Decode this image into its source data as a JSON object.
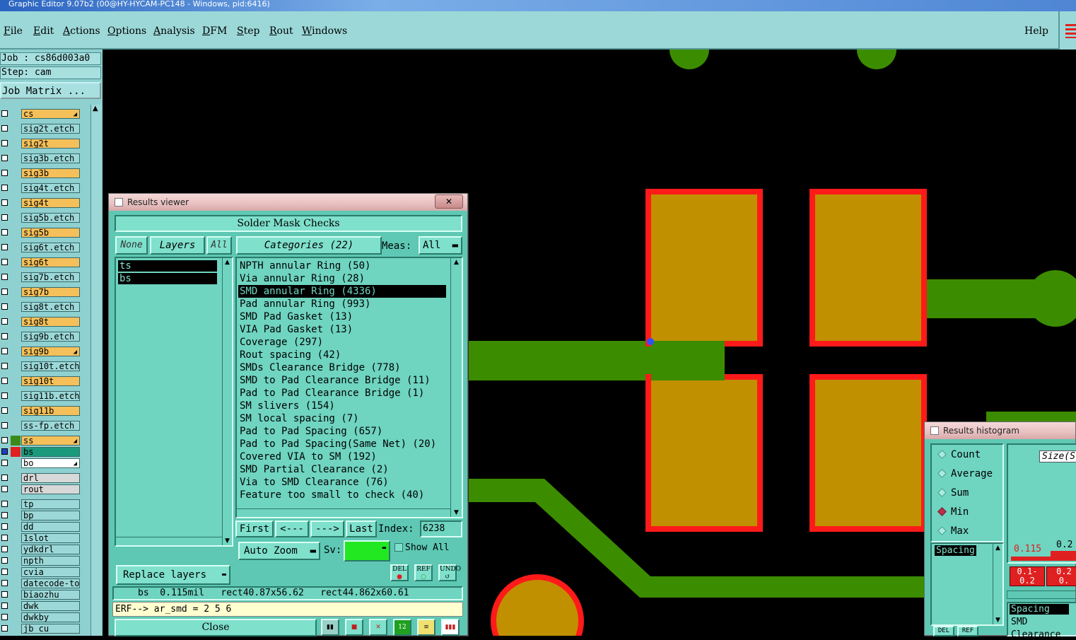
{
  "window": {
    "title": "Graphic Editor 9.07b2 (00@HY-HYCAM-PC148 - Windows, pid:6416)"
  },
  "menu": {
    "items": [
      {
        "label": "File",
        "u": "F",
        "rest": "ile"
      },
      {
        "label": "Edit",
        "u": "E",
        "rest": "dit"
      },
      {
        "label": "Actions",
        "u": "A",
        "rest": "ctions"
      },
      {
        "label": "Options",
        "u": "O",
        "rest": "ptions"
      },
      {
        "label": "Analysis",
        "u": "A",
        "rest": "nalysis"
      },
      {
        "label": "DFM",
        "u": "D",
        "rest": "FM"
      },
      {
        "label": "Step",
        "u": "S",
        "rest": "tep"
      },
      {
        "label": "Rout",
        "u": "R",
        "rest": "out"
      },
      {
        "label": "Windows",
        "u": "W",
        "rest": "indows"
      }
    ],
    "help": "Help"
  },
  "left": {
    "job": "Job : cs86d003a0",
    "step": "Step: cam",
    "job_matrix": "Job Matrix ...",
    "layers": [
      {
        "name": "cs",
        "color": "#f5c05a",
        "arrow": true
      },
      {
        "name": "sig2t.etch",
        "color": "#9cd8d8"
      },
      {
        "name": "sig2t",
        "color": "#f5c05a"
      },
      {
        "name": "sig3b.etch",
        "color": "#9cd8d8"
      },
      {
        "name": "sig3b",
        "color": "#f5c05a"
      },
      {
        "name": "sig4t.etch",
        "color": "#9cd8d8"
      },
      {
        "name": "sig4t",
        "color": "#f5c05a"
      },
      {
        "name": "sig5b.etch",
        "color": "#9cd8d8"
      },
      {
        "name": "sig5b",
        "color": "#f5c05a"
      },
      {
        "name": "sig6t.etch",
        "color": "#9cd8d8"
      },
      {
        "name": "sig6t",
        "color": "#f5c05a"
      },
      {
        "name": "sig7b.etch",
        "color": "#9cd8d8"
      },
      {
        "name": "sig7b",
        "color": "#f5c05a"
      },
      {
        "name": "sig8t.etch",
        "color": "#9cd8d8"
      },
      {
        "name": "sig8t",
        "color": "#f5c05a"
      },
      {
        "name": "sig9b.etch",
        "color": "#9cd8d8"
      },
      {
        "name": "sig9b",
        "color": "#f5c05a",
        "arrow": true
      },
      {
        "name": "sig10t.etch",
        "color": "#9cd8d8"
      },
      {
        "name": "sig10t",
        "color": "#f5c05a"
      },
      {
        "name": "sig11b.etch",
        "color": "#9cd8d8"
      },
      {
        "name": "sig11b",
        "color": "#f5c05a"
      },
      {
        "name": "ss-fp.etch",
        "color": "#9cd8d8"
      }
    ],
    "mask_layers": [
      {
        "name": "ss",
        "color": "#f5c05a",
        "swatch": "#3a8a1a",
        "arrow": true
      },
      {
        "name": "bs",
        "color": "#1a9a7a",
        "swatch": "#e02020",
        "sel": true
      },
      {
        "name": "bo",
        "color": "#ffffff",
        "arrow": true
      }
    ],
    "drill_layers": [
      "drl",
      "rout"
    ],
    "doc_layers": [
      "tp",
      "bp",
      "dd",
      "1slot",
      "ydkdrl",
      "npth",
      "cvia",
      "datecode-to",
      "biaozhu",
      "dwk",
      "dwkby",
      "jb_cu"
    ]
  },
  "results_viewer": {
    "title": "Results viewer",
    "header": "Solder Mask Checks",
    "none": "None",
    "layers_btn": "Layers",
    "all": "All",
    "categories_btn": "Categories (22)",
    "meas_label": "Meas:",
    "meas_value": "All",
    "layers": [
      "ts",
      "bs"
    ],
    "categories": [
      "NPTH annular Ring (50)",
      "Via annular Ring (28)",
      "SMD annular Ring (4336)",
      "Pad annular Ring (993)",
      "SMD Pad Gasket (13)",
      "VIA Pad Gasket (13)",
      "Coverage (297)",
      "Rout spacing (42)",
      "SMDs Clearance Bridge (778)",
      "SMD to Pad Clearance Bridge (11)",
      "Pad to Pad Clearance Bridge (1)",
      "SM slivers (154)",
      "SM local spacing (7)",
      "Pad to Pad Spacing (657)",
      "Pad to Pad Spacing(Same Net) (20)",
      "Covered VIA to SM (192)",
      "SMD Partial Clearance (2)",
      "Via to SMD Clearance (76)",
      "Feature too small to check (40)"
    ],
    "selected_index": 2,
    "first": "First",
    "prev": "<---",
    "next": "--->",
    "last": "Last",
    "index_label": "Index:",
    "index_value": "6238",
    "zoom_btn": "Auto Zoom",
    "sv_label": "Sv:",
    "show_all": "Show All",
    "replace_btn": "Replace layers",
    "del": "DEL",
    "ref": "REF",
    "undo": "UNDO",
    "info": "bs  0.115mil   rect40.87x56.62   rect44.862x60.61",
    "erf": "ERF--> ar_smd = 2 5 6",
    "close": "Close"
  },
  "histogram": {
    "title": "Results histogram",
    "options": [
      "Count",
      "Average",
      "Sum",
      "Min",
      "Max"
    ],
    "selected": "Min",
    "list": [
      "Spacing"
    ],
    "size_label": "Size(S",
    "val1": "0.115",
    "val2": "0.2",
    "bin1": "0.1-",
    "bin1b": "0.2",
    "bin2": "0.2",
    "bin2b": "0.",
    "list2": [
      "Spacing",
      "SMD",
      "Clearance"
    ],
    "del": "DEL",
    "ref": "REF"
  },
  "colors": {
    "pad": "#c09000",
    "outline": "#ff1a1a",
    "trace": "#3c8c00",
    "panel": "#6fd4c0"
  }
}
